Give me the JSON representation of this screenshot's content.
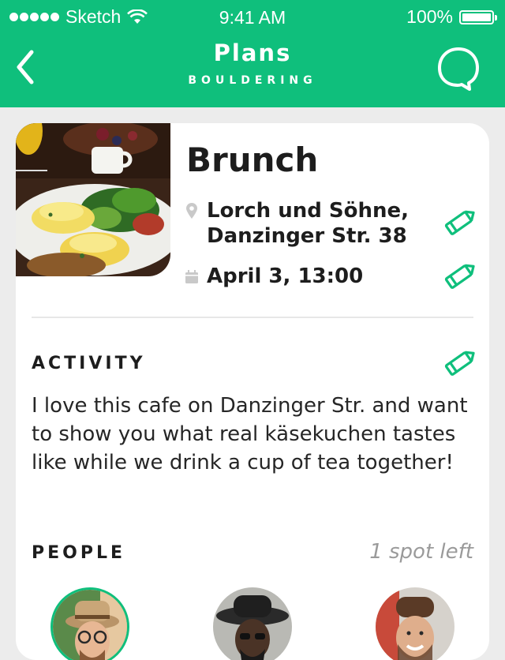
{
  "status_bar": {
    "carrier": "Sketch",
    "time": "9:41 AM",
    "battery": "100%"
  },
  "nav": {
    "title": "Plans",
    "subtitle": "BOULDERING",
    "back_icon": "chevron-left-icon",
    "chat_icon": "speech-bubble-icon"
  },
  "plan": {
    "title": "Brunch",
    "location": "Lorch und Söhne,\nDanzinger Str. 38",
    "date": "April 3, 13:00"
  },
  "activity": {
    "label": "ACTIVITY",
    "text": "I love this cafe on Danzinger Str. and want to show you what real käsekuchen tastes like while we drink a cup of tea together!"
  },
  "people": {
    "label": "PEOPLE",
    "spots": "1 spot left"
  },
  "colors": {
    "accent": "#0fbf7c",
    "background": "#ececec"
  }
}
